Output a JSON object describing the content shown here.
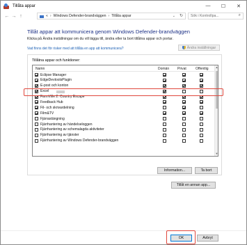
{
  "window": {
    "title": "Tillåta appar",
    "minimize_glyph": "—",
    "maximize_glyph": "☐",
    "close_glyph": "✕"
  },
  "address_bar": {
    "back_glyph": "←",
    "forward_glyph": "→",
    "up_glyph": "↑",
    "path_prefix": "«",
    "crumbs": [
      "Windows Defender-brandväggen",
      "Tillåta appar"
    ],
    "separator": "›",
    "dropdown_glyph": "⌄",
    "refresh_glyph": "↻",
    "search_placeholder": "Sök i Kontrollpa...",
    "search_glyph": "⌕"
  },
  "content": {
    "heading": "Tillåt appar att kommunicera genom Windows Defender-brandväggen",
    "description": "Klicka på Ändra inställningar om du vill lägga till, ändra eller ta bort tillåtna appar och portar.",
    "risk_link": "Vad finns det för risker med att tillåta en app att kommunicera?",
    "change_settings_label": "Ändra inställningar",
    "group_title": "Tillåtna appar och funktioner:",
    "columns": {
      "name": "Namn",
      "domain": "Domän",
      "private": "Privat",
      "public": "Offentlig"
    },
    "apps": [
      {
        "name": "Eclipse Manager",
        "checked": true,
        "domain": true,
        "private": true,
        "public": true
      },
      {
        "name": "EdgeDevtoolsPlugin",
        "checked": true,
        "domain": true,
        "private": true,
        "public": true
      },
      {
        "name": "E-post och konton",
        "checked": true,
        "domain": true,
        "private": true,
        "public": true
      },
      {
        "name": "Excel",
        "checked": true,
        "domain": true,
        "private": false,
        "public": false,
        "highlighted": true,
        "redacted_suffix": true
      },
      {
        "name": "FarmVille 2: Country Escape",
        "checked": true,
        "domain": true,
        "private": true,
        "public": true
      },
      {
        "name": "Feedback Hub",
        "checked": true,
        "domain": true,
        "private": true,
        "public": true
      },
      {
        "name": "Fil- och skrivardelning",
        "checked": true,
        "domain": false,
        "private": true,
        "public": false
      },
      {
        "name": "Film&TV",
        "checked": true,
        "domain": true,
        "private": true,
        "public": true
      },
      {
        "name": "Fjärrastängning",
        "checked": false,
        "domain": false,
        "private": false,
        "public": false
      },
      {
        "name": "Fjärrhantering av händelseloggen",
        "checked": false,
        "domain": false,
        "private": false,
        "public": false
      },
      {
        "name": "Fjärrhantering av schemalagda aktiviteter",
        "checked": false,
        "domain": false,
        "private": false,
        "public": false
      },
      {
        "name": "Fjärrhantering av tjänster",
        "checked": false,
        "domain": false,
        "private": false,
        "public": false
      },
      {
        "name": "Fjärrhantering av Windows Defender-brandväggen",
        "checked": false,
        "domain": false,
        "private": false,
        "public": false
      }
    ],
    "scroll_up_glyph": "▲",
    "scroll_down_glyph": "▼",
    "info_button": "Information...",
    "remove_button": "Ta bort",
    "allow_other_button": "Tillåt en annan app..."
  },
  "footer": {
    "ok_button": "OK",
    "cancel_button": "Avbryt"
  }
}
